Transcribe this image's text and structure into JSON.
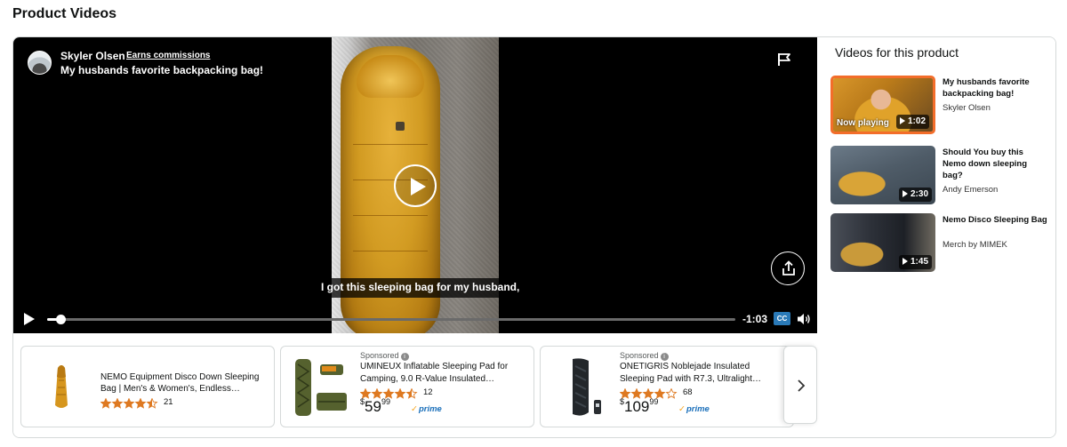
{
  "page": {
    "title": "Product Videos"
  },
  "player": {
    "creator_name": "Skyler Olsen",
    "earns_commissions": "Earns commissions",
    "video_title": "My husbands favorite backpacking bag!",
    "caption": "I got this sleeping bag for my husband,",
    "time_remaining": "-1:03",
    "cc_label": "CC",
    "progress": 0.02
  },
  "sidebar": {
    "heading": "Videos for this product",
    "videos": [
      {
        "title": "My husbands favorite backpacking bag!",
        "creator": "Skyler Olsen",
        "duration": "1:02",
        "now_playing": "Now playing"
      },
      {
        "title": "Should You buy this Nemo down sleeping bag?",
        "creator": "Andy Emerson",
        "duration": "2:30"
      },
      {
        "title": "Nemo Disco Sleeping Bag",
        "creator": "Merch by MIMEK",
        "duration": "1:45"
      }
    ]
  },
  "products": [
    {
      "title_line1": "NEMO Equipment Disco Down Sleeping",
      "title_line2": "Bag | Men's & Women's, Endless…",
      "rating": 4.5,
      "rating_count": "21"
    },
    {
      "sponsored": "Sponsored",
      "title_line1": "UMINEUX Inflatable Sleeping Pad for",
      "title_line2": "Camping, 9.0 R-Value Insulated…",
      "rating": 4.5,
      "rating_count": "12",
      "price_currency": "$",
      "price_whole": "59",
      "price_fraction": "99",
      "prime": "prime"
    },
    {
      "sponsored": "Sponsored",
      "title_line1": "ONETIGRIS Noblejade Insulated",
      "title_line2": "Sleeping Pad with R7.3, Ultralight…",
      "rating": 4.0,
      "rating_count": "68",
      "price_currency": "$",
      "price_whole": "109",
      "price_fraction": "99",
      "prime": "prime"
    }
  ],
  "colors": {
    "accent": "#f36d2a",
    "star": "#de7921",
    "prime": "#1a6fba",
    "cc": "#2a7ab8"
  }
}
